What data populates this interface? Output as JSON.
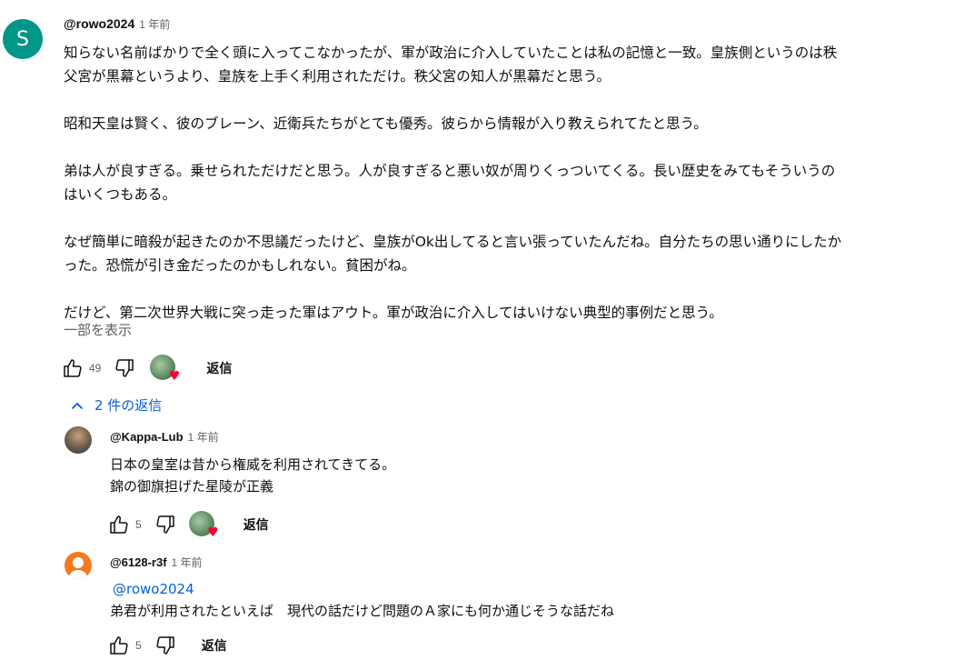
{
  "comment": {
    "avatar_letter": "S",
    "author": "@rowo2024",
    "time": "1 年前",
    "paragraphs": [
      "知らない名前ばかりで全く頭に入ってこなかったが、軍が政治に介入していたことは私の記憶と一致。皇族側というのは秩\n父宮が黒幕というより、皇族を上手く利用されただけ。秩父宮の知人が黒幕だと思う。",
      "昭和天皇は賢く、彼のブレーン、近衛兵たちがとても優秀。彼らから情報が入り教えられてたと思う。",
      "弟は人が良すぎる。乗せられただけだと思う。人が良すぎると悪い奴が周りくっついてくる。長い歴史をみてもそういうの\nはいくつもある。",
      "なぜ簡単に暗殺が起きたのか不思議だったけど、皇族がOk出してると言い張っていたんだね。自分たちの思い通りにしたか\nった。恐慌が引き金だったのかもしれない。貧困がね。",
      "だけど、第二次世界大戦に突っ走った軍はアウト。軍が政治に介入してはいけない典型的事例だと思う。"
    ],
    "show_more": "一部を表示",
    "like_count": "49",
    "reply_label": "返信"
  },
  "replies_toggle": {
    "chevron": "^",
    "label": "2 件の返信"
  },
  "replies": [
    {
      "author": "@Kappa-Lub",
      "time": "1 年前",
      "lines": [
        "日本の皇室は昔から権威を利用されてきてる。",
        "錦の御旗担げた星陵が正義"
      ],
      "like_count": "5",
      "reply_label": "返信"
    },
    {
      "author": "@6128-r3f",
      "time": "1 年前",
      "mention": "@rowo2024",
      "lines": [
        "弟君が利用されたといえば　現代の話だけど問題のＡ家にも何か通じそうな話だね"
      ],
      "like_count": "5",
      "reply_label": "返信"
    }
  ],
  "colors": {
    "main_avatar": "#009688",
    "link_blue": "#065fd4",
    "heart_red": "#ff0033",
    "secondary_text": "#606060"
  }
}
